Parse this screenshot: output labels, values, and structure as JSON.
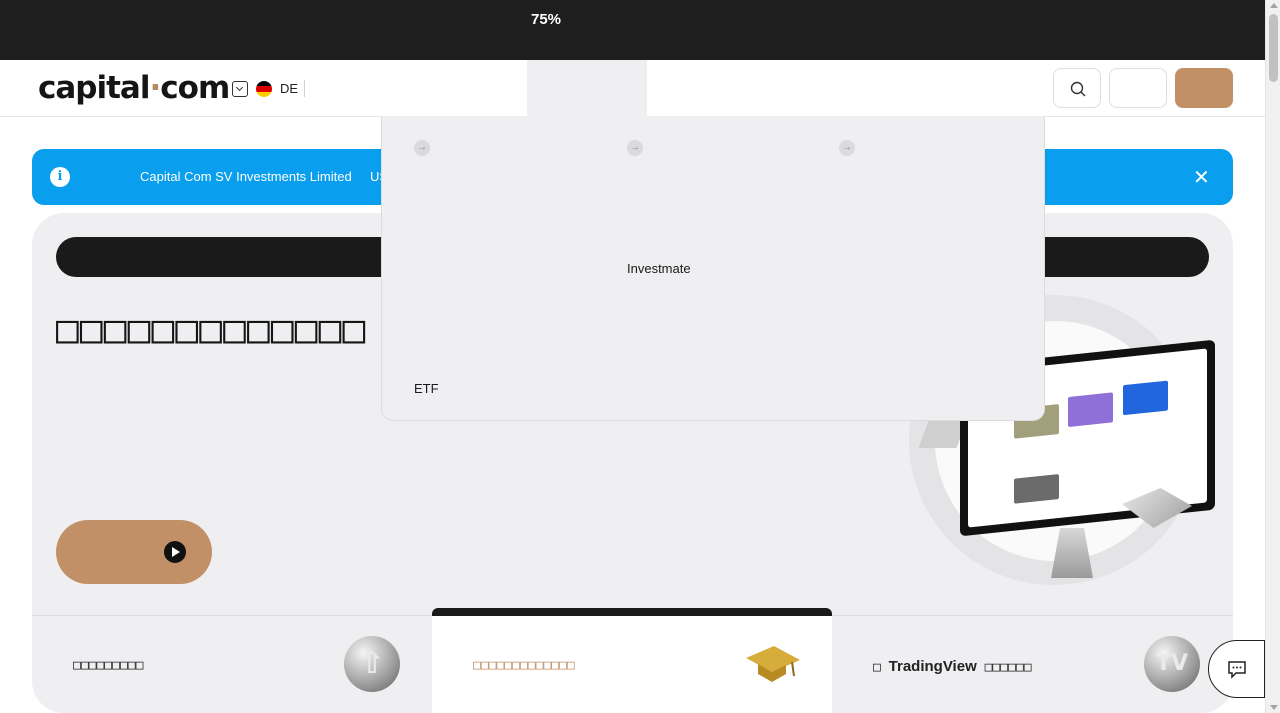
{
  "promo": {
    "percent": "75%"
  },
  "header": {
    "logo_main": "capital",
    "logo_dot": "·",
    "logo_tld": "com",
    "language_code": "DE",
    "flag_colors": [
      "#000000",
      "#dd0000",
      "#ffce00"
    ],
    "accent_color": "#c19066"
  },
  "banner": {
    "info_symbol": "i",
    "company": "Capital Com SV Investments Limited",
    "extra": "US",
    "close_symbol": "✕",
    "background_color": "#0a9fee"
  },
  "hero": {
    "title": "□□□□□□□□□□□□□",
    "tabs": [
      {
        "label": "□□□□□□□□□",
        "icon": "arrow-up-coin-icon",
        "symbol": "⇧"
      },
      {
        "label": "□□□□□□□□□□□□□",
        "icon": "graduation-cap-icon"
      },
      {
        "label_prefix": "□ ",
        "label_brand": "TradingView",
        "label_suffix": " □□□□□□",
        "icon": "tradingview-coin-icon",
        "symbol": "TV"
      }
    ]
  },
  "dropdown": {
    "link_1": "Investmate",
    "link_2": "ETF",
    "arrow_symbol": "→"
  }
}
